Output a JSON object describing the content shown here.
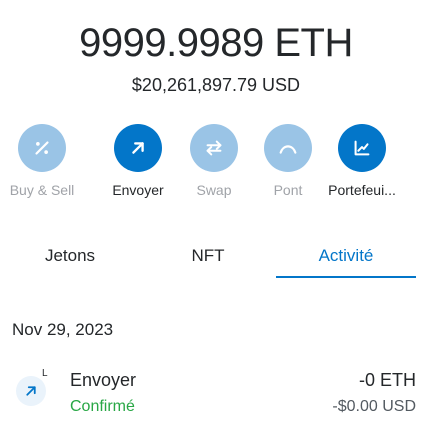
{
  "balance": {
    "primary": "9999.9989 ETH",
    "fiat": "$20,261,897.79 USD"
  },
  "actions": [
    {
      "label": "Buy & Sell",
      "icon": "buy-sell-icon",
      "enabled": false
    },
    {
      "label": "Envoyer",
      "icon": "send-arrow-icon",
      "enabled": true
    },
    {
      "label": "Swap",
      "icon": "swap-icon",
      "enabled": false
    },
    {
      "label": "Pont",
      "icon": "bridge-icon",
      "enabled": false
    },
    {
      "label": "Portefeui...",
      "icon": "portfolio-chart-icon",
      "enabled": true
    }
  ],
  "tabs": [
    {
      "label": "Jetons",
      "active": false
    },
    {
      "label": "NFT",
      "active": false
    },
    {
      "label": "Activité",
      "active": true
    }
  ],
  "activity": {
    "date": "Nov 29, 2023",
    "items": [
      {
        "badge": "L",
        "title": "Envoyer",
        "status": "Confirmé",
        "amount": "-0 ETH",
        "fiat": "-$0.00 USD"
      }
    ]
  },
  "colors": {
    "accent": "#0376c9",
    "accent_disabled": "#9ac4e6",
    "success": "#28a745",
    "text": "#24272a",
    "muted": "#a0a3a8"
  }
}
